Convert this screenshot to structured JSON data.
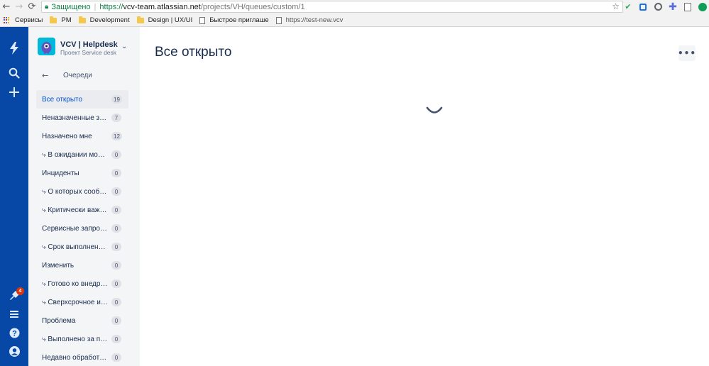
{
  "browser": {
    "secure_label": "Защищено",
    "url_proto": "https://",
    "url_host": "vcv-team.atlassian.net",
    "url_path": "/projects/VH/queues/custom/1",
    "bookmarks": [
      "Сервисы",
      "PM",
      "Development",
      "Design | UX/UI",
      "Быстрое приглаше",
      "https://test-new.vcv"
    ]
  },
  "global_nav": {
    "notifications_count": "4"
  },
  "project": {
    "name": "VCV | Helpdesk",
    "type": "Проект Service desk",
    "back_label": "Очереди"
  },
  "queues": [
    {
      "label": "Все открыто",
      "count": "19",
      "active": true
    },
    {
      "label": "Неназначенные запросы",
      "count": "7"
    },
    {
      "label": "Назначено мне",
      "count": "12"
    },
    {
      "label": "⤷ В ожидании моих действий",
      "count": "0"
    },
    {
      "label": "Инциденты",
      "count": "0"
    },
    {
      "label": "⤷ О которых сообщили",
      "count": "0"
    },
    {
      "label": "⤷ Критически важное",
      "count": "0"
    },
    {
      "label": "Сервисные запросы",
      "count": "0"
    },
    {
      "label": "⤷ Срок выполнения истекает",
      "count": "0"
    },
    {
      "label": "Изменить",
      "count": "0"
    },
    {
      "label": "⤷ Готово ко внедрению",
      "count": "0"
    },
    {
      "label": "⤷ Сверхсрочное изменение",
      "count": "0"
    },
    {
      "label": "Проблема",
      "count": "0"
    },
    {
      "label": "⤷ Выполнено за последнее время",
      "count": "0"
    },
    {
      "label": "Недавно обработано",
      "count": "0"
    }
  ],
  "main": {
    "title": "Все открыто"
  },
  "colors": {
    "global_nav_bg": "#0747a6",
    "sidebar_bg": "#f4f5f7",
    "accent": "#0052cc"
  }
}
